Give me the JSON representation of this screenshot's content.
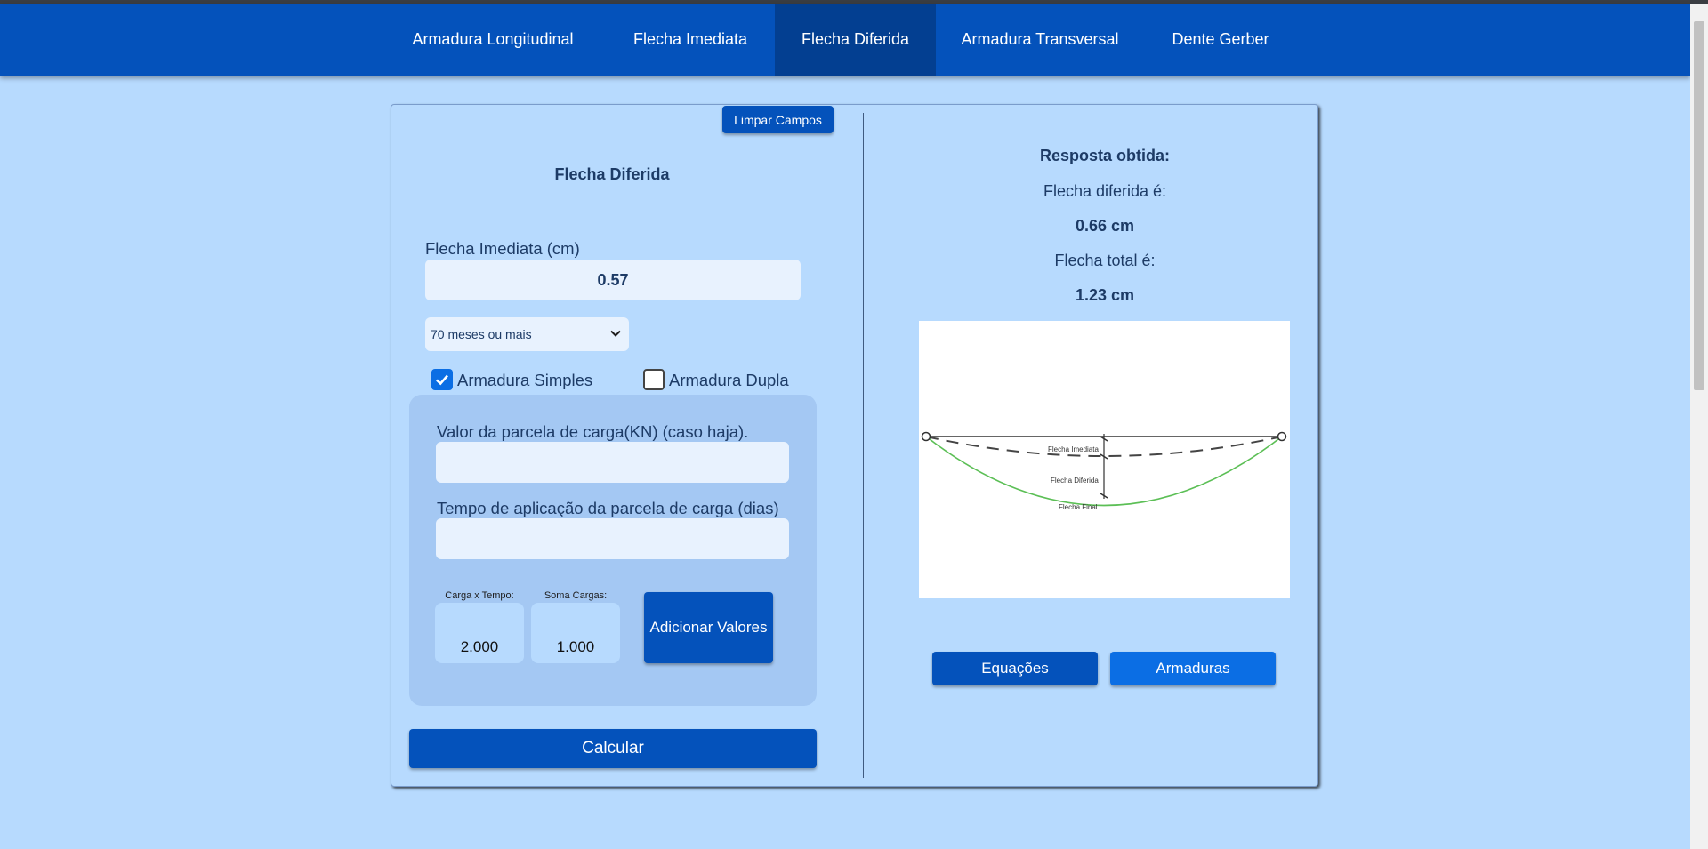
{
  "nav": {
    "items": [
      {
        "label": "Armadura Longitudinal"
      },
      {
        "label": "Flecha Imediata"
      },
      {
        "label": "Flecha Diferida"
      },
      {
        "label": "Armadura Transversal"
      },
      {
        "label": "Dente Gerber"
      }
    ],
    "active": "Flecha Diferida"
  },
  "form": {
    "clear_label": "Limpar Campos",
    "title": "Flecha Diferida",
    "flecha_imediata_label": "Flecha Imediata (cm)",
    "flecha_imediata_value": "0.57",
    "duration_selected": "70 meses ou mais",
    "checkbox_simples": {
      "label": "Armadura Simples",
      "checked": true
    },
    "checkbox_dupla": {
      "label": "Armadura Dupla",
      "checked": false
    },
    "carga_label": "Valor da parcela de carga(KN) (caso haja).",
    "carga_value": "",
    "tempo_label": "Tempo de aplicação da parcela de carga (dias)",
    "tempo_value": "",
    "carga_tempo_label": "Carga x Tempo:",
    "carga_tempo_value": "2.000",
    "soma_cargas_label": "Soma Cargas:",
    "soma_cargas_value": "1.000",
    "add_label": "Adicionar Valores",
    "calc_label": "Calcular"
  },
  "result": {
    "heading": "Resposta obtida:",
    "diferida_label": "Flecha diferida é:",
    "diferida_value": "0.66 cm",
    "total_label": "Flecha total é:",
    "total_value": "1.23 cm"
  },
  "diagram": {
    "label_imediata": "Flecha Imediata",
    "label_diferida": "Flecha Diferida",
    "label_final": "Flecha Final",
    "curve_color": "#5cbf56"
  },
  "buttons": {
    "equacoes": "Equações",
    "armaduras": "Armaduras"
  },
  "colors": {
    "primary": "#0452bb",
    "primary_light": "#0b6ee4",
    "background": "#b7dafe"
  }
}
